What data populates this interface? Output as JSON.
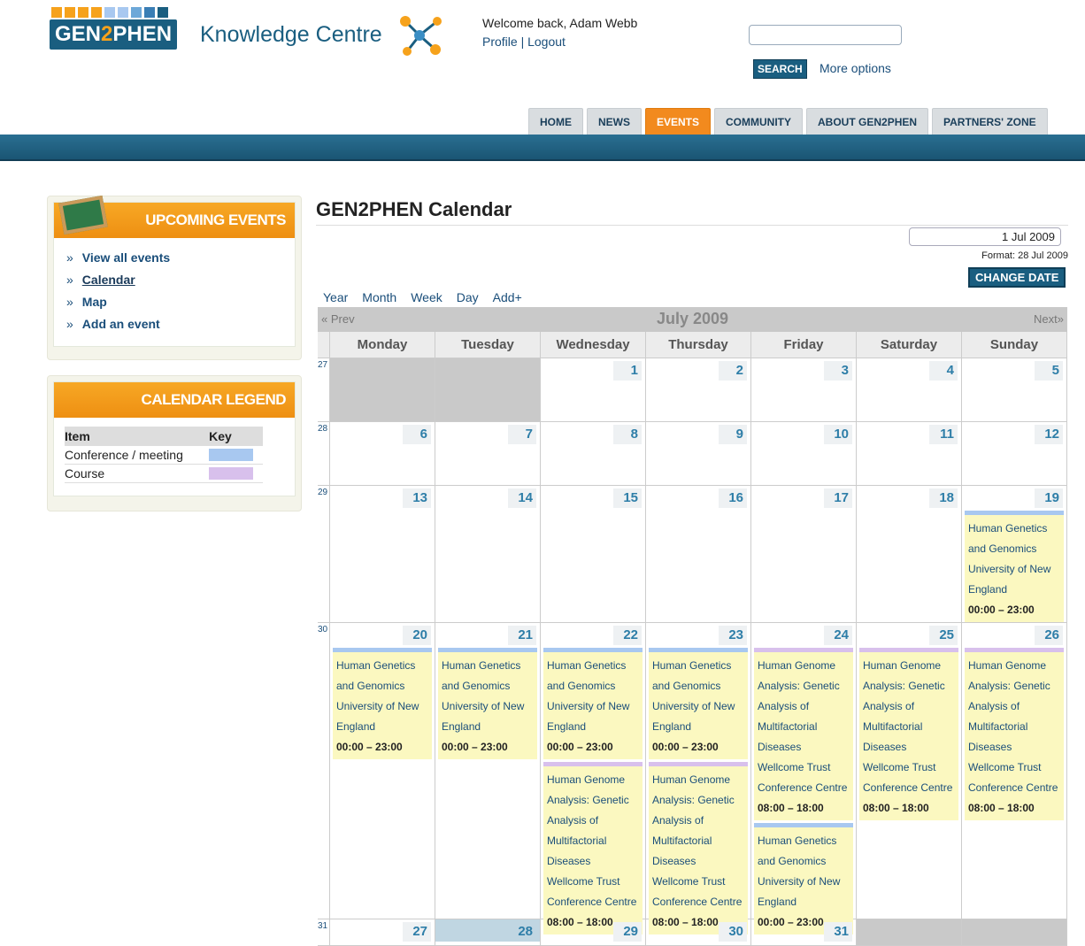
{
  "header": {
    "logo": {
      "brand_pre": "GEN",
      "brand_mid": "2",
      "brand_post": "PHEN",
      "subtitle": "Knowledge Centre"
    },
    "welcome": "Welcome back, Adam Webb",
    "profile_link": "Profile",
    "separator": "|",
    "logout_link": "Logout",
    "search_placeholder": "",
    "search_button": "SEARCH",
    "more_options": "More options"
  },
  "nav": {
    "tabs": [
      {
        "label": "HOME"
      },
      {
        "label": "NEWS"
      },
      {
        "label": "EVENTS",
        "active": true
      },
      {
        "label": "COMMUNITY"
      },
      {
        "label": "ABOUT GEN2PHEN"
      },
      {
        "label": "PARTNERS' ZONE"
      }
    ]
  },
  "sidebar": {
    "upcoming_title": "UPCOMING EVENTS",
    "links": [
      "View all events",
      "Calendar",
      "Map",
      "Add an event"
    ],
    "legend_title": "CALENDAR LEGEND",
    "legend_headers": {
      "item": "Item",
      "key": "Key"
    },
    "legend_rows": [
      {
        "item": "Conference / meeting",
        "color": "#a8c8f0"
      },
      {
        "item": "Course",
        "color": "#d8c0ec"
      }
    ]
  },
  "calendar": {
    "title": "GEN2PHEN Calendar",
    "date_value": "1 Jul 2009",
    "date_format": "Format: 28 Jul 2009",
    "change_button": "CHANGE DATE",
    "views": [
      "Year",
      "Month",
      "Week",
      "Day",
      "Add+"
    ],
    "prev": "« Prev",
    "next": "Next»",
    "month": "July 2009",
    "weekdays": [
      "Monday",
      "Tuesday",
      "Wednesday",
      "Thursday",
      "Friday",
      "Saturday",
      "Sunday"
    ],
    "weeks": [
      {
        "num": "27",
        "days": [
          "",
          "",
          "1",
          "2",
          "3",
          "4",
          "5"
        ]
      },
      {
        "num": "28",
        "days": [
          "6",
          "7",
          "8",
          "9",
          "10",
          "11",
          "12"
        ]
      },
      {
        "num": "29",
        "days": [
          "13",
          "14",
          "15",
          "16",
          "17",
          "18",
          "19"
        ]
      },
      {
        "num": "30",
        "days": [
          "20",
          "21",
          "22",
          "23",
          "24",
          "25",
          "26"
        ]
      },
      {
        "num": "31",
        "days": [
          "27",
          "28",
          "29",
          "30",
          "31",
          "",
          ""
        ]
      }
    ],
    "events": {
      "hg": {
        "type": "conf",
        "lines": [
          "Human Genetics",
          "and Genomics",
          "University of New",
          "England"
        ],
        "time": "00:00 – 23:00"
      },
      "hga": {
        "type": "course",
        "lines": [
          "Human Genome",
          "Analysis: Genetic",
          "Analysis of",
          "Multifactorial",
          "Diseases",
          "Wellcome Trust",
          "Conference Centre"
        ],
        "time": "08:00 – 18:00"
      }
    }
  }
}
